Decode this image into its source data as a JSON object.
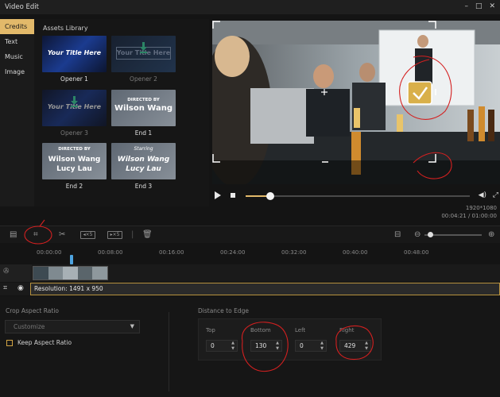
{
  "window": {
    "title": "Video Edit",
    "controls": [
      "–",
      "□",
      "✕"
    ]
  },
  "categories": [
    {
      "label": "Credits",
      "active": true
    },
    {
      "label": "Text",
      "active": false
    },
    {
      "label": "Music",
      "active": false
    },
    {
      "label": "Image",
      "active": false
    }
  ],
  "assets": {
    "title": "Assets Library",
    "items": [
      {
        "label": "Opener 1",
        "thumb_text": "Your Title Here"
      },
      {
        "label": "Opener 2",
        "thumb_text": "Your Title Here"
      },
      {
        "label": "Opener 3",
        "thumb_text": "Your Title Here"
      },
      {
        "label": "End 1",
        "thumb_small": "DIRECTED BY",
        "thumb_big": "Wilson Wang"
      },
      {
        "label": "End 2",
        "thumb_small": "DIRECTED BY",
        "thumb_l1": "Wilson Wang",
        "thumb_l2": "Lucy Lau"
      },
      {
        "label": "End 3",
        "thumb_small": "Starring",
        "thumb_l1": "Wilson Wang",
        "thumb_l2": "Lucy Lau"
      }
    ]
  },
  "player": {
    "resolution": "1920*1080",
    "time": "00:04:21 / 01:00:00",
    "progress": 0.11
  },
  "timeline": {
    "ticks": [
      "00:00:00",
      "00:08:00",
      "00:16:00",
      "00:24:00",
      "00:32:00",
      "00:40:00",
      "00:48:00"
    ],
    "zoom_level": 0.1
  },
  "toolbar": {
    "speed_down": "◂×5",
    "speed_up": "▸×5"
  },
  "crop": {
    "resolution_text": "Resolution: 1491 x 950",
    "aspect_label": "Crop Aspect Ratio",
    "aspect_value": "Customize",
    "keep_aspect_label": "Keep Aspect Ratio",
    "distance_label": "Distance to Edge",
    "fields": [
      {
        "label": "Top",
        "value": "0"
      },
      {
        "label": "Bottom",
        "value": "130"
      },
      {
        "label": "Left",
        "value": "0"
      },
      {
        "label": "Right",
        "value": "429"
      }
    ]
  },
  "colors": {
    "accent": "#e2b96a",
    "annotation": "#d42020"
  }
}
